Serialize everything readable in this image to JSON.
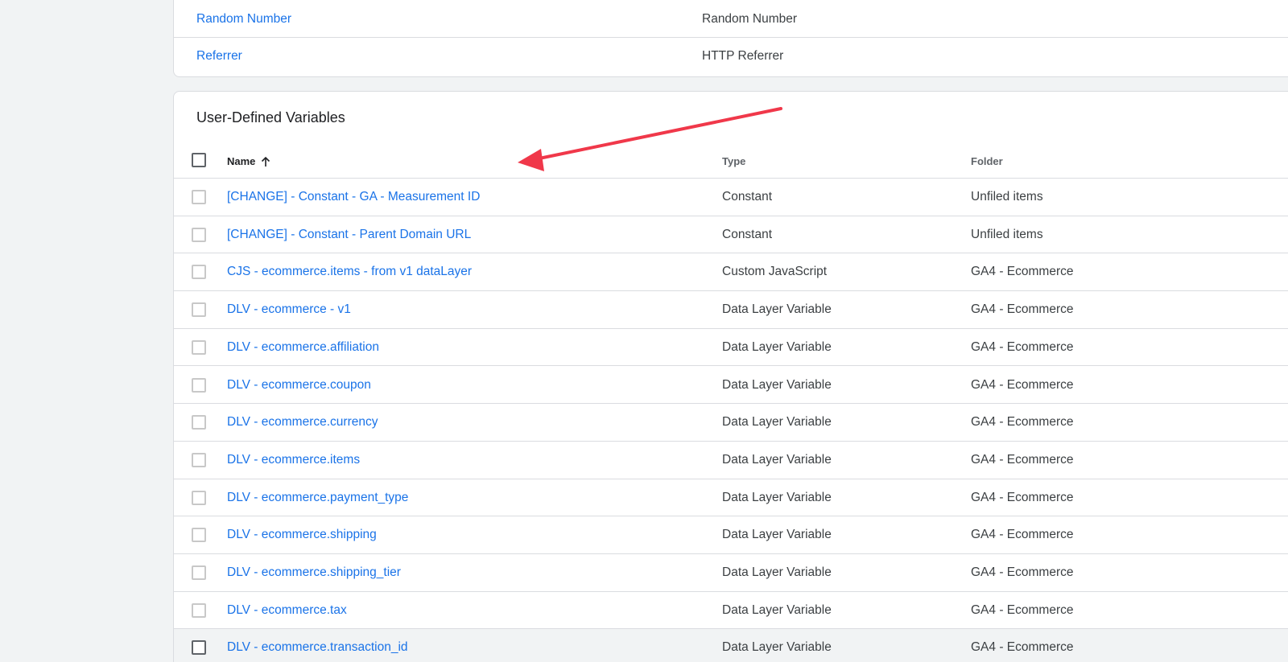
{
  "builtin_variables": {
    "rows": [
      {
        "name": "Random Number",
        "type": "Random Number"
      },
      {
        "name": "Referrer",
        "type": "HTTP Referrer"
      }
    ]
  },
  "user_defined": {
    "title": "User-Defined Variables",
    "columns": {
      "name": "Name",
      "type": "Type",
      "folder": "Folder"
    },
    "sort": {
      "column": "Name",
      "direction": "ascending",
      "icon": "arrow-up-icon"
    },
    "rows": [
      {
        "name": "[CHANGE] - Constant - GA - Measurement ID",
        "type": "Constant",
        "folder": "Unfiled items"
      },
      {
        "name": "[CHANGE] - Constant - Parent Domain URL",
        "type": "Constant",
        "folder": "Unfiled items"
      },
      {
        "name": "CJS - ecommerce.items - from v1 dataLayer",
        "type": "Custom JavaScript",
        "folder": "GA4 - Ecommerce"
      },
      {
        "name": "DLV - ecommerce - v1",
        "type": "Data Layer Variable",
        "folder": "GA4 - Ecommerce"
      },
      {
        "name": "DLV - ecommerce.affiliation",
        "type": "Data Layer Variable",
        "folder": "GA4 - Ecommerce"
      },
      {
        "name": "DLV - ecommerce.coupon",
        "type": "Data Layer Variable",
        "folder": "GA4 - Ecommerce"
      },
      {
        "name": "DLV - ecommerce.currency",
        "type": "Data Layer Variable",
        "folder": "GA4 - Ecommerce"
      },
      {
        "name": "DLV - ecommerce.items",
        "type": "Data Layer Variable",
        "folder": "GA4 - Ecommerce"
      },
      {
        "name": "DLV - ecommerce.payment_type",
        "type": "Data Layer Variable",
        "folder": "GA4 - Ecommerce"
      },
      {
        "name": "DLV - ecommerce.shipping",
        "type": "Data Layer Variable",
        "folder": "GA4 - Ecommerce"
      },
      {
        "name": "DLV - ecommerce.shipping_tier",
        "type": "Data Layer Variable",
        "folder": "GA4 - Ecommerce"
      },
      {
        "name": "DLV - ecommerce.tax",
        "type": "Data Layer Variable",
        "folder": "GA4 - Ecommerce"
      },
      {
        "name": "DLV - ecommerce.transaction_id",
        "type": "Data Layer Variable",
        "folder": "GA4 - Ecommerce"
      }
    ]
  },
  "colors": {
    "link": "#1a73e8",
    "text": "#3c4043",
    "annotation_arrow": "#f0384a",
    "background": "#f1f3f4"
  }
}
